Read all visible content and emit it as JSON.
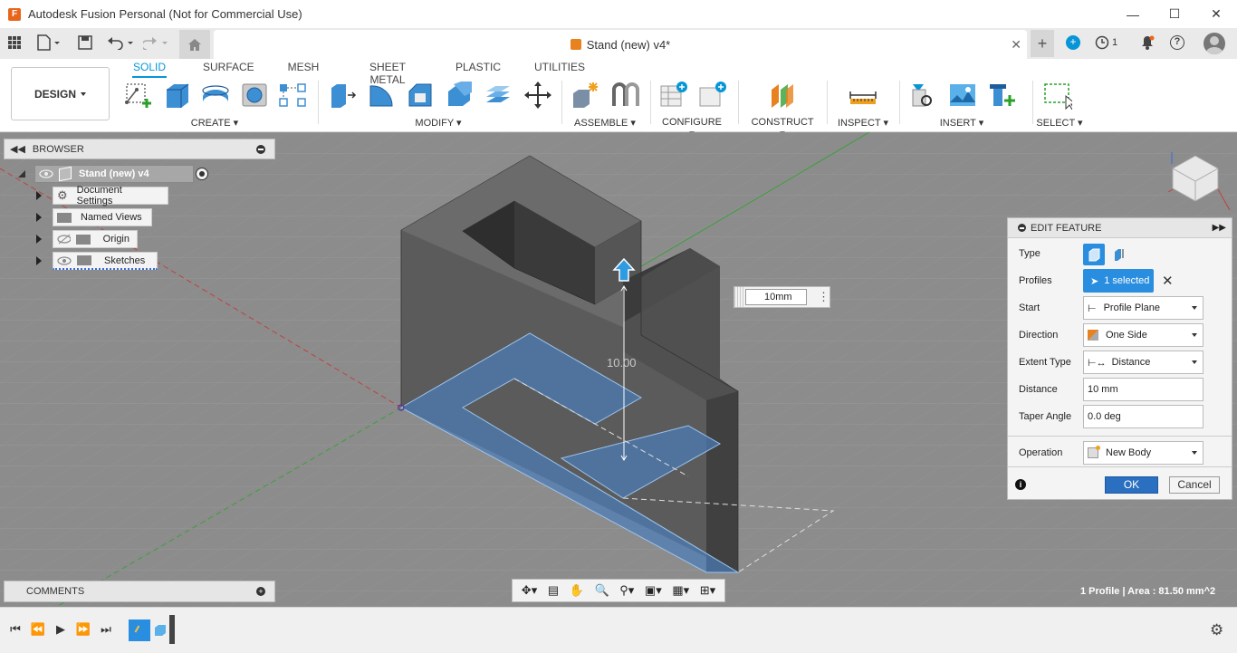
{
  "window": {
    "title": "Autodesk Fusion Personal (Not for Commercial Use)",
    "logo_letter": "F"
  },
  "tabbar": {
    "document_title": "Stand (new) v4*",
    "job_count": "1"
  },
  "toolbar": {
    "workspace": "DESIGN",
    "tabs": [
      "SOLID",
      "SURFACE",
      "MESH",
      "SHEET METAL",
      "PLASTIC",
      "UTILITIES"
    ],
    "active_tab": "SOLID",
    "groups": [
      "CREATE",
      "MODIFY",
      "ASSEMBLE",
      "CONFIGURE",
      "CONSTRUCT",
      "INSPECT",
      "INSERT",
      "SELECT"
    ]
  },
  "browser": {
    "title": "BROWSER",
    "root": "Stand (new) v4",
    "items": [
      {
        "label": "Document Settings",
        "icon": "gear-icon"
      },
      {
        "label": "Named Views",
        "icon": "folder-icon"
      },
      {
        "label": "Origin",
        "icon": "folder-icon"
      },
      {
        "label": "Sketches",
        "icon": "folder-icon"
      }
    ]
  },
  "comments": {
    "title": "COMMENTS"
  },
  "canvas": {
    "dimension_text": "10.00",
    "distance_input": "10mm",
    "status": "1 Profile | Area : 81.50 mm^2"
  },
  "edit_feature": {
    "title": "EDIT FEATURE",
    "type_label": "Type",
    "profiles_label": "Profiles",
    "profiles_value": "1 selected",
    "start_label": "Start",
    "start_value": "Profile Plane",
    "direction_label": "Direction",
    "direction_value": "One Side",
    "extent_label": "Extent Type",
    "extent_value": "Distance",
    "distance_label": "Distance",
    "distance_value": "10 mm",
    "taper_label": "Taper Angle",
    "taper_value": "0.0 deg",
    "operation_label": "Operation",
    "operation_value": "New Body",
    "ok_label": "OK",
    "cancel_label": "Cancel"
  },
  "colors": {
    "accent": "#0696d7",
    "viewport_bg": "#8e8e8e",
    "profile_fill": "#4a7db8"
  }
}
